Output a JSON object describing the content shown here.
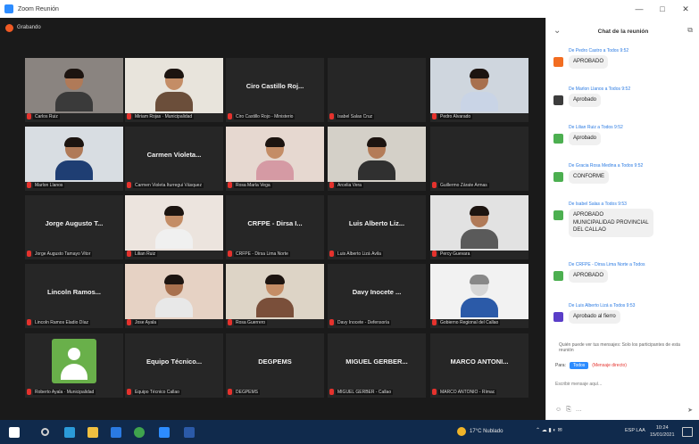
{
  "window": {
    "title": "Zoom Reunión",
    "minimize": "—",
    "maximize": "□",
    "close": "✕"
  },
  "meeting": {
    "recording_label": "Grabando"
  },
  "tiles": [
    {
      "kind": "video",
      "caption": "Carlos Ruiz",
      "video": {
        "bg": "#8a8480",
        "skin": "#b07a58",
        "shirt": "#3a3a3a",
        "hair": "#1c1410"
      }
    },
    {
      "kind": "video",
      "caption": "Miriam Rojas · Municipalidad",
      "video": {
        "bg": "#e8e4dc",
        "skin": "#c48d66",
        "shirt": "#6b4e3a",
        "hair": "#1c1410"
      }
    },
    {
      "kind": "name",
      "name": "Ciro Castillo Roj...",
      "caption": "Ciro Castillo Rojo - Ministerio"
    },
    {
      "kind": "name",
      "name": "",
      "caption": "Isabel Salas Cruz"
    },
    {
      "kind": "video",
      "caption": "Pedro Alvarado",
      "video": {
        "bg": "#cfd6de",
        "skin": "#a8704e",
        "shirt": "#c9d4e6",
        "hair": "#1c1410"
      }
    },
    {
      "kind": "video",
      "caption": "Marlon Llanos",
      "video": {
        "bg": "#d8dde2",
        "skin": "#b07a58",
        "shirt": "#1f3e73",
        "hair": "#1c1410"
      }
    },
    {
      "kind": "name",
      "name": "Carmen Violeta...",
      "caption": "Carmen Violeta Iturregui Vásquez"
    },
    {
      "kind": "video",
      "caption": "Rosa María Vega",
      "video": {
        "bg": "#e6d8d0",
        "skin": "#c48d66",
        "shirt": "#d59aa4",
        "hair": "#1c1410"
      }
    },
    {
      "kind": "video",
      "caption": "Arcelia Vera",
      "video": {
        "bg": "#d4d0c8",
        "skin": "#b47c58",
        "shirt": "#303030",
        "hair": "#1c1410"
      }
    },
    {
      "kind": "name",
      "name": "",
      "caption": "Guillermo Zárate Armas"
    },
    {
      "kind": "name",
      "name": "Jorge Augusto T...",
      "caption": "Jorge Augusto Tamayo Vitor"
    },
    {
      "kind": "video",
      "caption": "Lilian Ruiz",
      "video": {
        "bg": "#ece4de",
        "skin": "#c48d66",
        "shirt": "#f0f0f0",
        "hair": "#1c1410"
      }
    },
    {
      "kind": "name",
      "name": "CRFPE - Dirsa I...",
      "caption": "CRFPE - Dirsa Lima Norte"
    },
    {
      "kind": "name",
      "name": "Luis Alberto Liz...",
      "caption": "Luis Alberto Lizá Ávila"
    },
    {
      "kind": "video",
      "caption": "Percy Guevara",
      "video": {
        "bg": "#e2e2e2",
        "skin": "#b07a58",
        "shirt": "#5a5a5a",
        "hair": "#1c1410"
      }
    },
    {
      "kind": "name",
      "name": "Lincoln Ramos...",
      "caption": "Lincoln Ramos Eladio Díaz"
    },
    {
      "kind": "video",
      "caption": "Jose Ayala",
      "video": {
        "bg": "#e6d2c4",
        "skin": "#a8704e",
        "shirt": "#e8e8e8",
        "hair": "#1c1410"
      }
    },
    {
      "kind": "video",
      "caption": "Rosa Guerrero",
      "video": {
        "bg": "#ddd4c6",
        "skin": "#c48d66",
        "shirt": "#7a4f3a",
        "hair": "#1c1410"
      }
    },
    {
      "kind": "name",
      "name": "Davy Inocete ...",
      "caption": "Davy Inocete - Defensoría"
    },
    {
      "kind": "video",
      "caption": "Gobierno Regional del Callao",
      "video": {
        "bg": "#f2f2f2",
        "skin": "#d6d6d6",
        "shirt": "#2b5aa8",
        "hair": "#888888"
      }
    },
    {
      "kind": "avatar",
      "caption": "Roberto Ayala · Municipalidad"
    },
    {
      "kind": "name",
      "name": "Equipo Técnico...",
      "caption": "Equipo Técnico Callao"
    },
    {
      "kind": "name",
      "name": "DEGPEMS",
      "caption": "DEGPEMS"
    },
    {
      "kind": "name",
      "name": "MIGUEL GERBER...",
      "caption": "MIGUEL GERBER - Callao"
    },
    {
      "kind": "name",
      "name": "MARCO ANTONI...",
      "caption": "MARCO ANTONIO - Rímac"
    }
  ],
  "chat": {
    "title": "Chat de la reunión",
    "messages": [
      {
        "sender": "De Pedro Castro a Todos 9:52",
        "text": "APROBADO",
        "avatar_color": "#f26d21"
      },
      {
        "sender": "De Marlon Llanos a Todos 9:52",
        "text": "Aprobado",
        "avatar_color": "#3c3c3c"
      },
      {
        "sender": "De Lilian Ruiz a Todos 9:52",
        "text": "Aprobado",
        "avatar_color": "#4caf50"
      },
      {
        "sender": "De Gracia Rosa Medina a Todos 9:52",
        "text": "CONFORME",
        "avatar_color": "#4caf50"
      },
      {
        "sender": "De Isabel Salas a Todos 9:53",
        "text": "APROBADO\nMUNICIPALIDAD PROVINCIAL\nDEL CALLAO",
        "avatar_color": "#4caf50"
      },
      {
        "sender": "De CRFPE - Dirsa Lima Norte a Todos",
        "text": "APROBADO",
        "avatar_color": "#4caf50"
      },
      {
        "sender": "De Luis Alberto Lizá a Todos 9:53",
        "text": "Aprobado al fierro",
        "avatar_color": "#5a3ec8"
      }
    ],
    "compose": {
      "note": "Quién puede ver tus mensajes: Solo los participantes de esta reunión",
      "to_label": "Para:",
      "to_value": "Todos",
      "private_flag": "(Mensaje directo)",
      "placeholder": "Escribir mensaje aquí...",
      "tools": [
        "☺",
        "⎘",
        "…"
      ],
      "send": "➤"
    }
  },
  "taskbar": {
    "apps": [
      {
        "name": "windows",
        "color": "#ffffff"
      },
      {
        "name": "search",
        "color": "#cfcfcf"
      },
      {
        "name": "edge",
        "color": "#2b9bd9"
      },
      {
        "name": "file-explorer",
        "color": "#f0c040"
      },
      {
        "name": "store",
        "color": "#2a7ae2"
      },
      {
        "name": "chrome",
        "color": "#3fa34d"
      },
      {
        "name": "zoom",
        "color": "#2d8cff"
      },
      {
        "name": "word",
        "color": "#2b5aa8"
      }
    ],
    "weather": "17°C Nublado",
    "tray": "⌃  ☁  ▮  ◐  ✉",
    "lang": "ESP LAA",
    "time": "10:24",
    "date": "15/01/2021"
  }
}
